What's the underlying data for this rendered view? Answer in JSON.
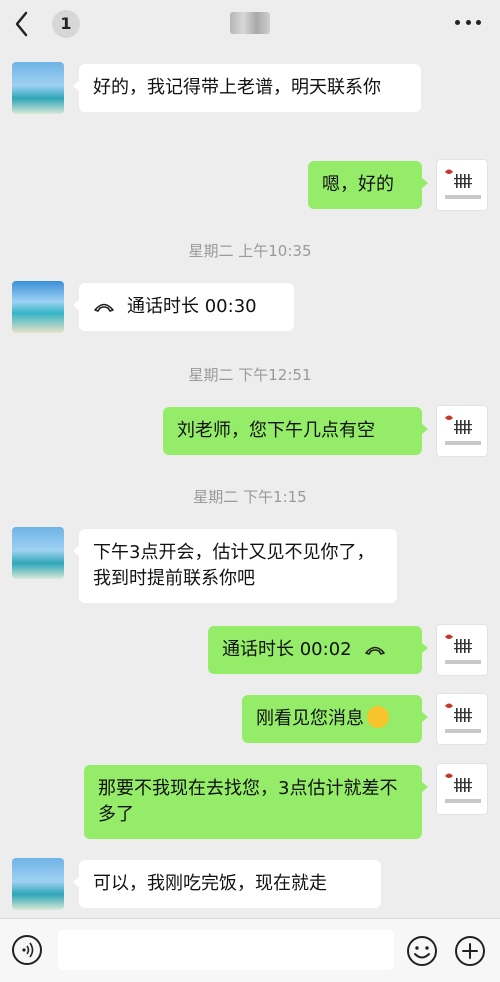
{
  "header": {
    "back_badge": "1"
  },
  "messages": [
    {
      "side": "left",
      "text": "好的，我记得带上老谱，明天联系你"
    },
    {
      "side": "right",
      "text": "嗯，好的"
    },
    {
      "type": "time",
      "text": "星期二 上午10:35"
    },
    {
      "side": "left",
      "type": "call",
      "text": "通话时长 00:30"
    },
    {
      "type": "time",
      "text": "星期二 下午12:51"
    },
    {
      "side": "right",
      "text": "刘老师，您下午几点有空"
    },
    {
      "type": "time",
      "text": "星期二 下午1:15"
    },
    {
      "side": "left",
      "text": "下午3点开会，估计又见不见你了，我到时提前联系你吧"
    },
    {
      "side": "right",
      "type": "call",
      "text": "通话时长 00:02"
    },
    {
      "side": "right",
      "text": "刚看见您消息"
    },
    {
      "side": "right",
      "text": "那要不我现在去找您，3点估计就差不多了"
    },
    {
      "side": "left",
      "text": "可以，我刚吃完饭，现在就走"
    }
  ],
  "icons": {
    "back": "chevron-left-icon",
    "more": "more-dots-icon",
    "voice": "voice-input-icon",
    "emoji": "emoji-icon",
    "plus": "plus-icon",
    "call": "phone-hangup-icon"
  },
  "colors": {
    "sent_bubble": "#95ec69",
    "received_bubble": "#ffffff",
    "background": "#ededed"
  }
}
